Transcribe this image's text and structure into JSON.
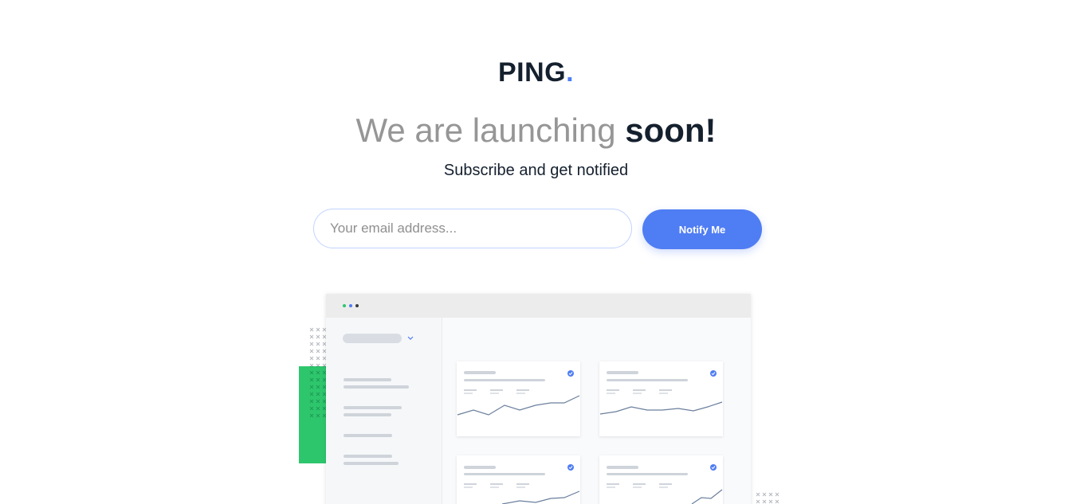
{
  "brand": {
    "name": "PING",
    "dot": ".",
    "accent_color": "#4f7df3"
  },
  "headline": {
    "light": "We are launching ",
    "bold": "soon!"
  },
  "subtitle": "Subscribe and get notified",
  "form": {
    "email_placeholder": "Your email address...",
    "email_value": "",
    "submit_label": "Notify Me"
  },
  "illustration": {
    "name": "dashboard-illustration",
    "window_dot_colors": [
      "#2ec66d",
      "#4f7df3",
      "#3c3c3c"
    ],
    "accent_green": "#2ec66d"
  }
}
